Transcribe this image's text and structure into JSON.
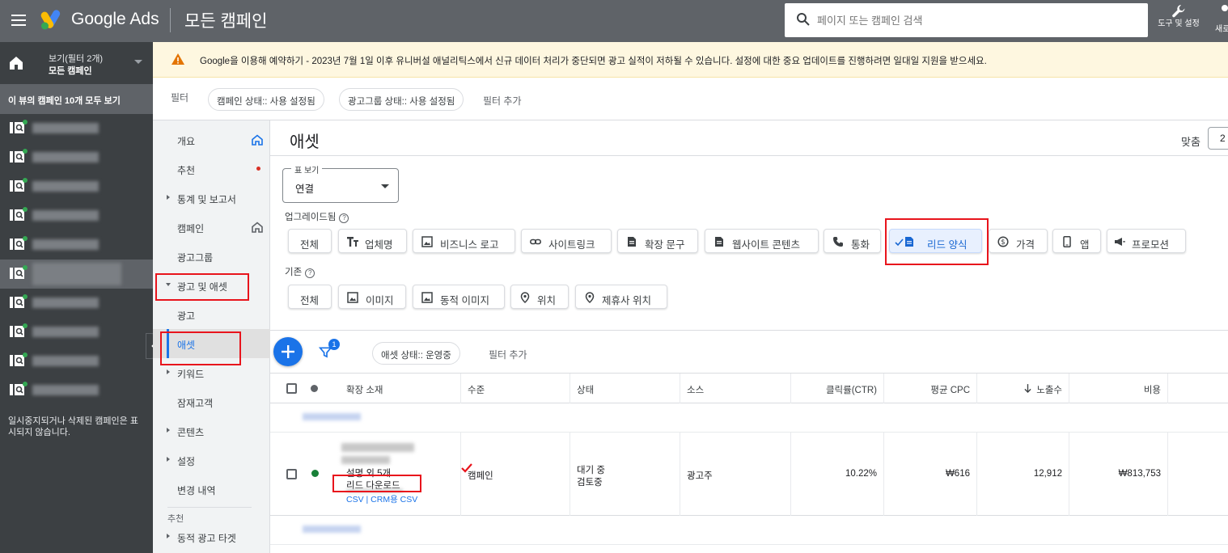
{
  "header": {
    "brand": "Google Ads",
    "page_title": "모든 캠페인",
    "search_placeholder": "페이지 또는 캠페인 검색",
    "tools_label": "도구 및 설정",
    "refresh_label": "새로"
  },
  "account": {
    "view_label": "보기(필터 2개)",
    "scope_label": "모든 캠페인",
    "view_all": "이 뷰의 캠페인 10개 모두 보기",
    "paused_note": "일시중지되거나 삭제된 캠페인은 표시되지 않습니다."
  },
  "notice": {
    "text": "Google을 이용해 예약하기 - 2023년 7월 1일 이후 유니버설 애널리틱스에서 신규 데이터 처리가 중단되면 광고 실적이 저하될 수 있습니다. 설정에 대한 중요 업데이트를 진행하려면 일대일 지원을 받으세요."
  },
  "filters": {
    "label": "필터",
    "chips": [
      "캠페인 상태:: 사용 설정됨",
      "광고그룹 상태:: 사용 설정됨"
    ],
    "add": "필터 추가"
  },
  "nav": {
    "overview": "개요",
    "recommendations": "추천",
    "stats": "통계 및 보고서",
    "campaigns": "캠페인",
    "adgroups": "광고그룹",
    "ads_assets": "광고 및 애셋",
    "ads": "광고",
    "assets": "애셋",
    "keywords": "키워드",
    "audiences": "잠재고객",
    "content": "콘텐츠",
    "settings": "설정",
    "change_history": "변경 내역",
    "group_recommended": "추천",
    "dynamic_targets": "동적 광고 타겟"
  },
  "main": {
    "title": "애셋",
    "fit_label": "맞춤",
    "fit_value": "2",
    "view": {
      "legend": "표 보기",
      "value": "연결"
    },
    "upgraded_label": "업그레이드됨",
    "upgraded_buttons": [
      "전체",
      "업체명",
      "비즈니스 로고",
      "사이트링크",
      "확장 문구",
      "웹사이트 콘텐츠",
      "통화",
      "리드 양식",
      "가격",
      "앱",
      "프로모션"
    ],
    "basic_label": "기존",
    "basic_buttons": [
      "전체",
      "이미지",
      "동적 이미지",
      "위치",
      "제휴사 위치"
    ],
    "table_filter_chip": "애셋 상태:: 운영중",
    "table_add_filter": "필터 추가",
    "funnel_badge": "1"
  },
  "table": {
    "columns": [
      "확장 소재",
      "수준",
      "상태",
      "소스",
      "클릭률(CTR)",
      "평균 CPC",
      "노출수",
      "비용"
    ],
    "row": {
      "desc": "설명 외 5개",
      "title": "리드 다운로드",
      "links": "CSV | CRM용 CSV",
      "level": "캠페인",
      "status_1": "대기 중",
      "status_2": "검토중",
      "source": "광고주",
      "ctr": "10.22%",
      "cpc": "₩616",
      "impressions": "12,912",
      "cost": "₩813,753"
    }
  },
  "colors": {
    "topbar": "#5f6368",
    "accent": "#1a73e8",
    "highlight": "#e8141c"
  }
}
